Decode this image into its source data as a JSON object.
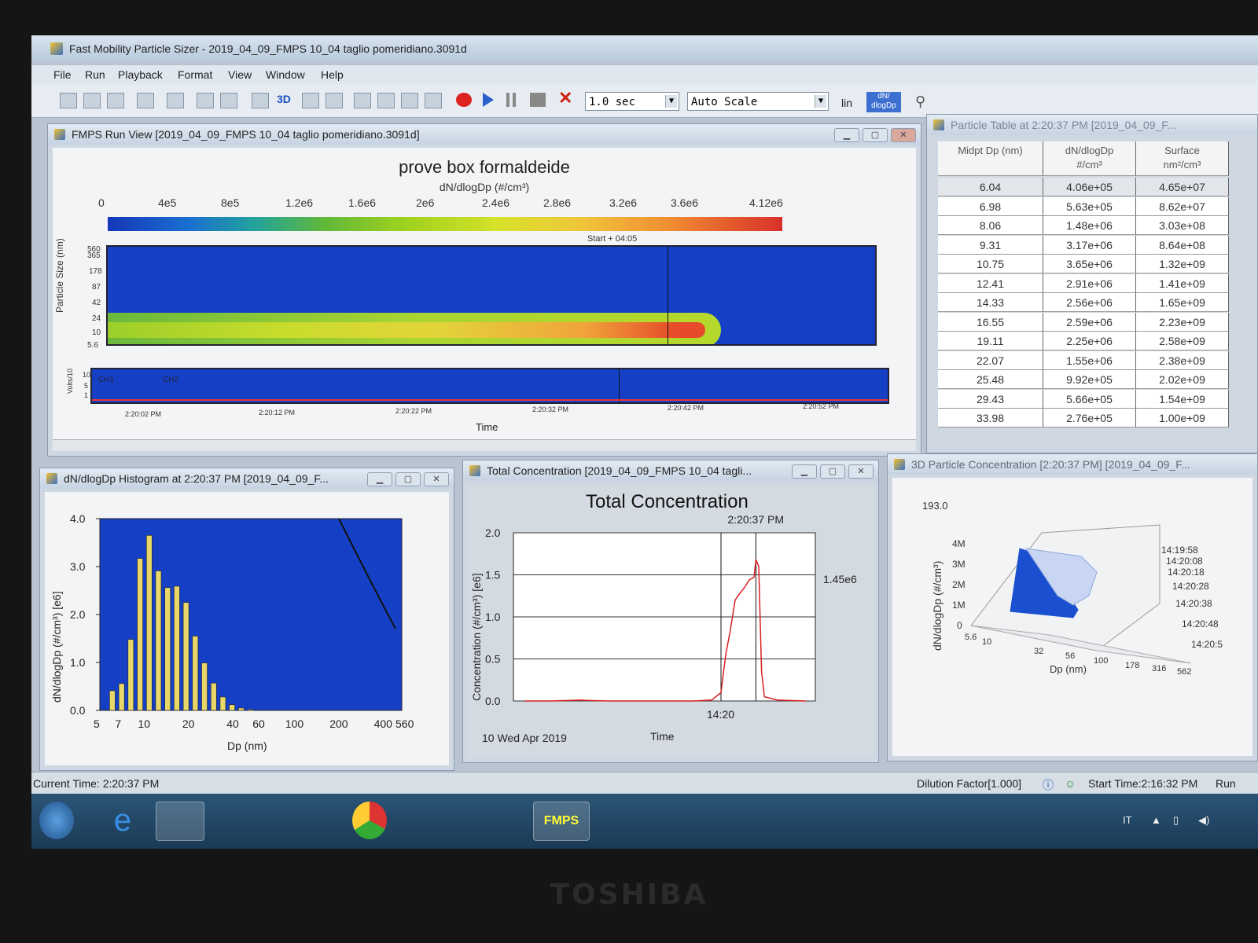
{
  "app": {
    "title": "Fast Mobility Particle Sizer - 2019_04_09_FMPS 10_04 taglio pomeridiano.3091d",
    "menu": [
      "File",
      "Run",
      "Playback",
      "Format",
      "View",
      "Window",
      "Help"
    ],
    "toolbar": {
      "interval": "1.0 sec",
      "scale": "Auto Scale",
      "lin": "lin",
      "dn_button": "dN/\ndlogDp",
      "three_d": "3D"
    }
  },
  "run_view": {
    "title": "FMPS Run View  [2019_04_09_FMPS 10_04 taglio pomeridiano.3091d]",
    "plot_title": "prove box formaldeide",
    "plot_subtitle": "dN/dlogDp (#/cm³)",
    "colorbar_ticks": [
      "0",
      "4e5",
      "8e5",
      "1.2e6",
      "1.6e6",
      "2e6",
      "2.4e6",
      "2.8e6",
      "3.2e6",
      "3.6e6",
      "4.12e6"
    ],
    "cursor_label": "Start + 04:05",
    "y_axis_label": "Particle Size (nm)",
    "y_ticks": [
      "560",
      "365",
      "178",
      "87",
      "42",
      "24",
      "10",
      "5.6"
    ],
    "strip_legend": [
      "CH1",
      "CH2"
    ],
    "strip_y_label": "Volts/10",
    "strip_y_ticks": [
      "10",
      "5",
      "1"
    ],
    "time_ticks": [
      "2:20:02 PM",
      "2:20:12 PM",
      "2:20:22 PM",
      "2:20:32 PM",
      "2:20:42 PM",
      "2:20:52 PM"
    ],
    "x_axis_label": "Time"
  },
  "particle_table": {
    "title": "Particle Table at  2:20:37 PM  [2019_04_09_F...",
    "columns": [
      "Midpt Dp (nm)",
      "dN/dlogDp\n#/cm³",
      "Surface\nnm²/cm³"
    ],
    "rows": [
      [
        "6.04",
        "4.06e+05",
        "4.65e+07"
      ],
      [
        "6.98",
        "5.63e+05",
        "8.62e+07"
      ],
      [
        "8.06",
        "1.48e+06",
        "3.03e+08"
      ],
      [
        "9.31",
        "3.17e+06",
        "8.64e+08"
      ],
      [
        "10.75",
        "3.65e+06",
        "1.32e+09"
      ],
      [
        "12.41",
        "2.91e+06",
        "1.41e+09"
      ],
      [
        "14.33",
        "2.56e+06",
        "1.65e+09"
      ],
      [
        "16.55",
        "2.59e+06",
        "2.23e+09"
      ],
      [
        "19.11",
        "2.25e+06",
        "2.58e+09"
      ],
      [
        "22.07",
        "1.55e+06",
        "2.38e+09"
      ],
      [
        "25.48",
        "9.92e+05",
        "2.02e+09"
      ],
      [
        "29.43",
        "5.66e+05",
        "1.54e+09"
      ],
      [
        "33.98",
        "2.76e+05",
        "1.00e+09"
      ]
    ]
  },
  "histogram": {
    "title": "dN/dlogDp Histogram at 2:20:37 PM  [2019_04_09_F...",
    "y_label": "dN/dlogDp (#/cm³) [e6]",
    "x_label": "Dp (nm)",
    "y_ticks": [
      "4.0",
      "3.0",
      "2.0",
      "1.0",
      "0.0"
    ],
    "x_ticks": [
      "5",
      "7",
      "10",
      "20",
      "40",
      "60",
      "100",
      "200",
      "400",
      "560"
    ]
  },
  "total_conc": {
    "title": "Total Concentration  [2019_04_09_FMPS 10_04 tagli...",
    "plot_title": "Total Concentration",
    "cursor_label": "2:20:37 PM",
    "value_label": "1.45e6",
    "y_label": "Concentration (#/cm³) [e6]",
    "y_ticks": [
      "2.0",
      "1.5",
      "1.0",
      "0.5",
      "0.0"
    ],
    "x_tick": "14:20",
    "date_label": "10 Wed Apr 2019",
    "x_label": "Time"
  },
  "particle_3d": {
    "title": "3D Particle Concentration [2:20:37 PM]  [2019_04_09_F...",
    "top_value": "193.0",
    "y_label": "dN/dlogDp (#/cm³)",
    "z_ticks": [
      "4M",
      "3M",
      "2M",
      "1M",
      "0"
    ],
    "x_label": "Dp (nm)",
    "x_ticks": [
      "5.6",
      "10",
      "32",
      "56",
      "100",
      "178",
      "316",
      "562"
    ],
    "time_ticks": [
      "14:19:58",
      "14:20:08",
      "14:20:18",
      "14:20:28",
      "14:20:38",
      "14:20:48",
      "14:20:5"
    ]
  },
  "status": {
    "current_time": "Current Time: 2:20:37 PM",
    "dilution": "Dilution Factor[1.000]",
    "start_time": "Start Time:2:16:32 PM",
    "run": "Run"
  },
  "taskbar": {
    "active_app": "FMPS",
    "lang": "IT"
  },
  "chart_data": [
    {
      "type": "bar",
      "title": "",
      "xlabel": "Dp (nm)",
      "ylabel": "dN/dlogDp (#/cm³) [e6]",
      "ylim": [
        0,
        4.0
      ],
      "categories": [
        "6.04",
        "6.98",
        "8.06",
        "9.31",
        "10.75",
        "12.41",
        "14.33",
        "16.55",
        "19.11",
        "22.07",
        "25.48",
        "29.43",
        "33.98",
        "39.2",
        "45.3",
        "52.3"
      ],
      "values": [
        0.41,
        0.56,
        1.48,
        3.17,
        3.65,
        2.91,
        2.56,
        2.59,
        2.25,
        1.55,
        0.99,
        0.57,
        0.28,
        0.12,
        0.05,
        0.02
      ]
    },
    {
      "type": "line",
      "title": "Total Concentration",
      "xlabel": "Time",
      "ylabel": "Concentration (#/cm³) [e6]",
      "ylim": [
        0,
        2.0
      ],
      "series": [
        {
          "x": [
            "14:16:32",
            "14:17:00",
            "14:17:30",
            "14:18:00",
            "14:18:30",
            "14:19:00",
            "14:19:30",
            "14:19:50",
            "14:20:00",
            "14:20:05",
            "14:20:10",
            "14:20:15",
            "14:20:20",
            "14:20:25",
            "14:20:30",
            "14:20:35",
            "14:20:37",
            "14:20:40",
            "14:20:43",
            "14:20:46",
            "14:21:00",
            "14:21:30"
          ],
          "values": [
            0.0,
            0.0,
            0.01,
            0.0,
            0.0,
            0.0,
            0.0,
            0.01,
            0.1,
            0.55,
            0.85,
            1.2,
            1.28,
            1.35,
            1.44,
            1.47,
            1.68,
            1.6,
            0.35,
            0.05,
            0.01,
            0.0
          ]
        }
      ]
    }
  ]
}
